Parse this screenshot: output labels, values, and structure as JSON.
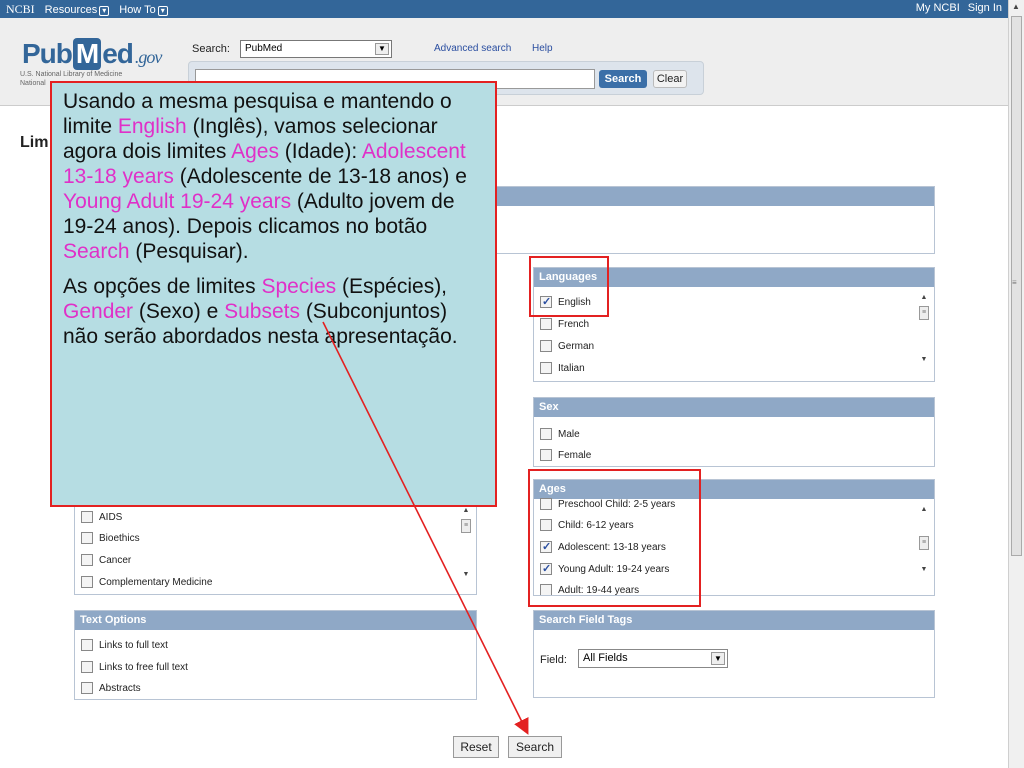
{
  "topbar": {
    "brand": "NCBI",
    "resources": "Resources",
    "howto": "How To",
    "my_ncbi": "My NCBI",
    "sign_in": "Sign In"
  },
  "header": {
    "logo_pub": "Pub",
    "logo_m": "M",
    "logo_ed": "ed",
    "logo_gov": ".gov",
    "logo_sub1": "U.S. National Library of Medicine",
    "logo_sub2": "National",
    "search_label": "Search:",
    "database": "PubMed",
    "advanced": "Advanced search",
    "help": "Help",
    "search_button": "Search",
    "clear_button": "Clear"
  },
  "page_title": "Lim",
  "languages": {
    "title": "Languages",
    "options": [
      {
        "label": "English",
        "checked": true
      },
      {
        "label": "French",
        "checked": false
      },
      {
        "label": "German",
        "checked": false
      },
      {
        "label": "Italian",
        "checked": false
      }
    ]
  },
  "sex": {
    "title": "Sex",
    "options": [
      {
        "label": "Male",
        "checked": false
      },
      {
        "label": "Female",
        "checked": false
      }
    ]
  },
  "ages": {
    "title": "Ages",
    "options": [
      {
        "label": "Preschool Child: 2-5 years",
        "checked": false
      },
      {
        "label": "Child: 6-12 years",
        "checked": false
      },
      {
        "label": "Adolescent: 13-18 years",
        "checked": true
      },
      {
        "label": "Young Adult: 19-24 years",
        "checked": true
      },
      {
        "label": "Adult: 19-44 years",
        "checked": false
      }
    ]
  },
  "subsets": {
    "options": [
      {
        "label": "AIDS",
        "checked": false
      },
      {
        "label": "Bioethics",
        "checked": false
      },
      {
        "label": "Cancer",
        "checked": false
      },
      {
        "label": "Complementary Medicine",
        "checked": false
      }
    ]
  },
  "text_options": {
    "title": "Text Options",
    "options": [
      {
        "label": "Links to full text",
        "checked": false
      },
      {
        "label": "Links to free full text",
        "checked": false
      },
      {
        "label": "Abstracts",
        "checked": false
      }
    ]
  },
  "search_field_tags": {
    "title": "Search Field Tags",
    "field_label": "Field:",
    "field_value": "All Fields"
  },
  "buttons": {
    "reset": "Reset",
    "search": "Search"
  },
  "callout": {
    "p1_a": "Usando a mesma pesquisa e mantendo o limite ",
    "p1_english": "English",
    "p1_b": " (Inglês), vamos selecionar agora dois limites ",
    "p1_ages": "Ages",
    "p1_c": " (Idade): ",
    "p1_adolescent": "Adolescent 13-18 years",
    "p1_d": " (Adolescente de 13-18 anos) e ",
    "p1_young": "Young Adult 19-24 years",
    "p1_e": " (Adulto jovem de 19-24 anos). Depois clicamos no botão ",
    "p1_search": "Search",
    "p1_f": " (Pesquisar).",
    "p2_a": "As opções de limites ",
    "p2_species": "Species",
    "p2_b": " (Espécies), ",
    "p2_gender": "Gender",
    "p2_c": " (Sexo) e ",
    "p2_subsets": "Subsets",
    "p2_d": " (Subconjuntos) não serão abordados nesta apresentação."
  },
  "colors": {
    "accent_highlight": "#e32121",
    "callout_bg": "#b6dde3",
    "keyword_pink": "#e030c8",
    "panel_header": "#8fa8c6",
    "topbar": "#336699"
  }
}
